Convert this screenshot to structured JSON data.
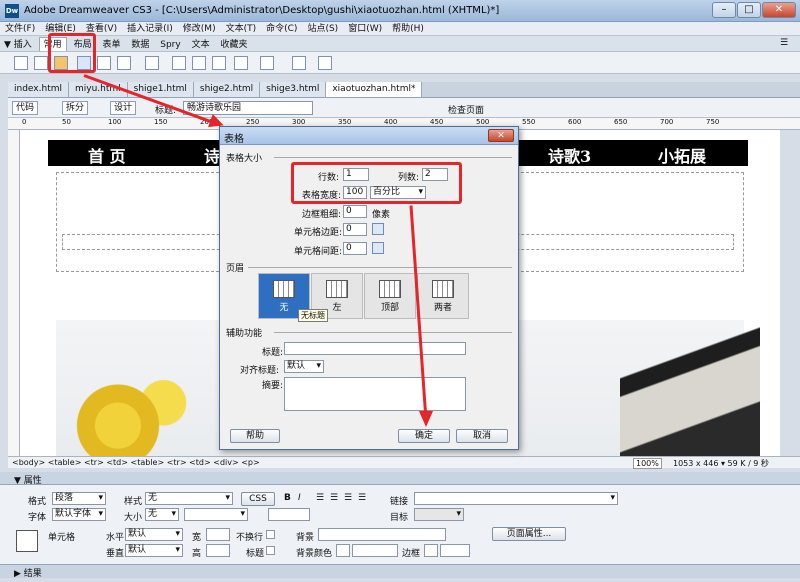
{
  "window": {
    "title": "Adobe Dreamweaver CS3 - [C:\\Users\\Administrator\\Desktop\\gushi\\xiaotuozhan.html (XHTML)*]",
    "minimize": "–",
    "maximize": "□",
    "close": "✕"
  },
  "menu": [
    "文件(F)",
    "编辑(E)",
    "查看(V)",
    "插入记录(I)",
    "修改(M)",
    "文本(T)",
    "命令(C)",
    "站点(S)",
    "窗口(W)",
    "帮助(H)"
  ],
  "insert_bar": {
    "title": "▼ 插入",
    "tabs": [
      "常用",
      "布局",
      "表单",
      "数据",
      "Spry",
      "文本",
      "收藏夹"
    ]
  },
  "doc_tabs": [
    "index.html",
    "miyu.html",
    "shige1.html",
    "shige2.html",
    "shige3.html",
    "xiaotuozhan.html*"
  ],
  "doc_toolbar": {
    "code": "代码",
    "split": "拆分",
    "design": "设计",
    "title_label": "标题:",
    "title_value": "畅游诗歌乐园",
    "check_page": "检查页面"
  },
  "ruler": [
    "0",
    "50",
    "100",
    "150",
    "200",
    "250",
    "300",
    "350",
    "400",
    "450",
    "500",
    "550",
    "600",
    "650",
    "700",
    "750"
  ],
  "banner": {
    "left": "首 页",
    "mid": "诗",
    "right1": "诗歌3",
    "right2": "小拓展"
  },
  "tag_selector": "<body> <table> <tr> <td> <table> <tr> <td> <div> <p>",
  "status": {
    "zoom": "100%",
    "size": "1053 x 446 ▾ 59 K / 9 秒"
  },
  "dialog": {
    "title": "表格",
    "close": "✕",
    "section_size": "表格大小",
    "rows_label": "行数:",
    "rows_value": "1",
    "cols_label": "列数:",
    "cols_value": "2",
    "width_label": "表格宽度:",
    "width_value": "100",
    "width_unit": "百分比",
    "border_label": "边框粗细:",
    "border_value": "0",
    "border_unit": "像素",
    "padding_label": "单元格边距:",
    "padding_value": "0",
    "spacing_label": "单元格间距:",
    "spacing_value": "0",
    "section_header": "页眉",
    "header_options": [
      "无",
      "左",
      "顶部",
      "两者"
    ],
    "tooltip": "无标题",
    "section_access": "辅助功能",
    "caption_label": "标题:",
    "align_label": "对齐标题:",
    "align_value": "默认",
    "summary_label": "摘要:",
    "help": "帮助",
    "ok": "确定",
    "cancel": "取消"
  },
  "properties": {
    "header": "▼ 属性",
    "format_label": "格式",
    "format_value": "段落",
    "style_label": "样式",
    "style_value": "无",
    "css_btn": "CSS",
    "bold": "B",
    "italic": "I",
    "link_label": "链接",
    "font_label": "字体",
    "font_value": "默认字体",
    "size_label": "大小",
    "size_value": "无",
    "target_label": "目标",
    "cell_label": "单元格",
    "horz_label": "水平",
    "horz_value": "默认",
    "width_label": "宽",
    "nowrap_label": "不换行",
    "bg_label": "背景",
    "page_props": "页面属性...",
    "vert_label": "垂直",
    "vert_value": "默认",
    "height_label": "高",
    "header_label": "标题",
    "bgcolor_label": "背景颜色",
    "border_label": "边框"
  },
  "footer": "▶ 结果",
  "colors": {
    "highlight": "#e4262a",
    "selected_header": "#2f6fc1"
  }
}
